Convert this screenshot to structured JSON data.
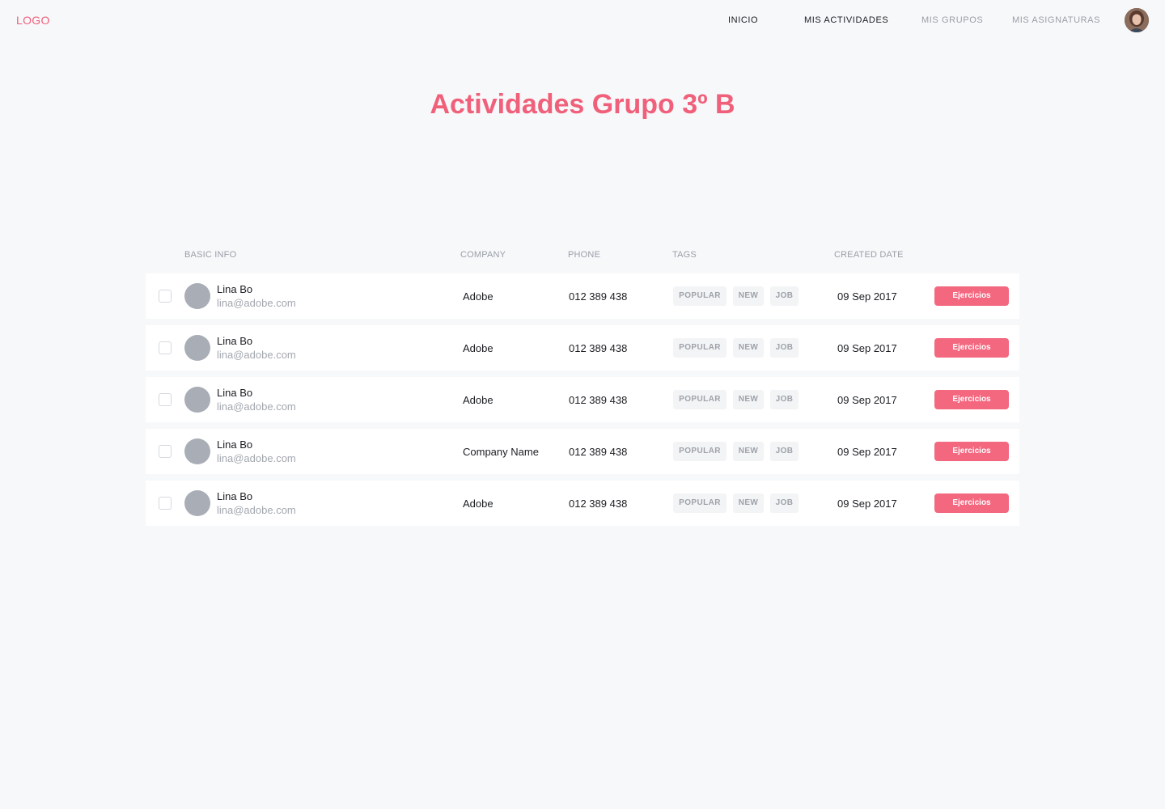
{
  "header": {
    "logo": "LOGO",
    "nav": [
      {
        "label": "INICIO",
        "active": true
      },
      {
        "label": "MIS ACTIVIDADES",
        "active": true
      },
      {
        "label": "MIS GRUPOS",
        "active": false
      },
      {
        "label": "MIS ASIGNATURAS",
        "active": false
      }
    ]
  },
  "main": {
    "title": "Actividades Grupo 3º B"
  },
  "table": {
    "columns": [
      "BASIC INFO",
      "COMPANY",
      "PHONE",
      "TAGS",
      "CREATED DATE"
    ],
    "rows": [
      {
        "name": "Lina Bo",
        "email": "lina@adobe.com",
        "company": "Adobe",
        "phone": "012 389 438",
        "tags": [
          "POPULAR",
          "NEW",
          "JOB"
        ],
        "date": "09 Sep 2017",
        "action": "Ejercicios"
      },
      {
        "name": "Lina Bo",
        "email": "lina@adobe.com",
        "company": "Adobe",
        "phone": "012 389 438",
        "tags": [
          "POPULAR",
          "NEW",
          "JOB"
        ],
        "date": "09 Sep 2017",
        "action": "Ejercicios"
      },
      {
        "name": "Lina Bo",
        "email": "lina@adobe.com",
        "company": "Adobe",
        "phone": "012 389 438",
        "tags": [
          "POPULAR",
          "NEW",
          "JOB"
        ],
        "date": "09 Sep 2017",
        "action": "Ejercicios"
      },
      {
        "name": "Lina Bo",
        "email": "lina@adobe.com",
        "company": "Company Name",
        "phone": "012 389 438",
        "tags": [
          "POPULAR",
          "NEW",
          "JOB"
        ],
        "date": "09 Sep 2017",
        "action": "Ejercicios"
      },
      {
        "name": "Lina Bo",
        "email": "lina@adobe.com",
        "company": "Adobe",
        "phone": "012 389 438",
        "tags": [
          "POPULAR",
          "NEW",
          "JOB"
        ],
        "date": "09 Sep 2017",
        "action": "Ejercicios"
      }
    ]
  },
  "colors": {
    "accent": "#f0607a",
    "button": "#f3677f",
    "background": "#f7f8fa"
  }
}
